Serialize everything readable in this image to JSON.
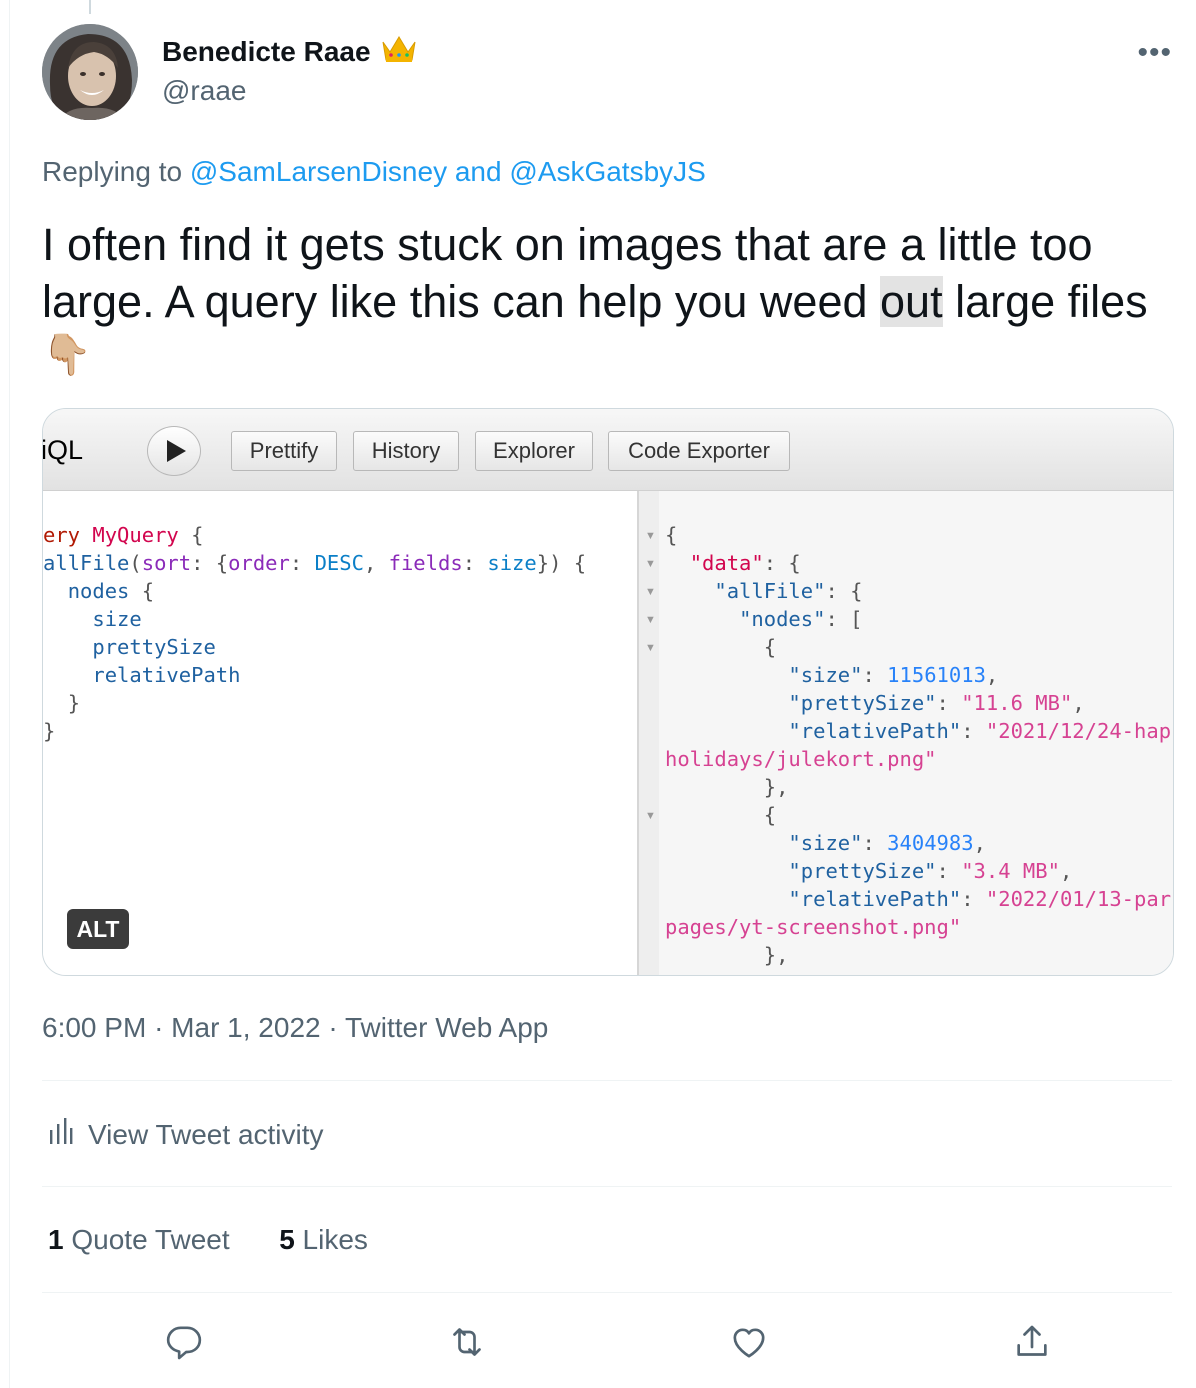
{
  "author": {
    "name": "Benedicte Raae",
    "badge_emoji": "👑",
    "handle": "@raae"
  },
  "more_label": "•••",
  "reply": {
    "prefix": "Replying to",
    "user1": "@SamLarsenDisney",
    "joiner": "and",
    "user2": "@AskGatsbyJS"
  },
  "tweet": {
    "line1": "I often find it gets stuck on images that are a little too",
    "line2_a": "large. A query like this can help you weed ",
    "line2_highlight": "out",
    "line2_b": " large files",
    "emoji": "👇🏼"
  },
  "media": {
    "toolbar": {
      "app_fragment": "iQL",
      "buttons": [
        "Prettify",
        "History",
        "Explorer",
        "Code Exporter"
      ]
    },
    "query": {
      "l1_kw": "ery",
      "l1_name": "MyQuery",
      "l1_brace": "{",
      "l2_field": "allFile",
      "l2_arg": "sort",
      "l2_k1": "order",
      "l2_v1": "DESC",
      "l2_k2": "fields",
      "l2_v2": "size",
      "l3": "nodes",
      "l4": "size",
      "l5": "prettySize",
      "l6": "relativePath"
    },
    "result": {
      "k_data": "\"data\"",
      "k_allfile": "\"allFile\"",
      "k_nodes": "\"nodes\"",
      "k_size": "\"size\"",
      "k_pretty": "\"prettySize\"",
      "k_rel": "\"relativePath\"",
      "n1_size": "11561013",
      "n1_pretty": "\"11.6 MB\"",
      "n1_path_a": "\"2021/12/24-hap",
      "n1_path_b": "holidays/julekort.png\"",
      "n2_size": "3404983",
      "n2_pretty": "\"3.4 MB\"",
      "n2_path_a": "\"2022/01/13-par",
      "n2_path_b": "pages/yt-screenshot.png\""
    },
    "alt_badge": "ALT"
  },
  "meta": {
    "time": "6:00 PM",
    "date": "Mar 1, 2022",
    "source": "Twitter Web App"
  },
  "activity_label": "View Tweet activity",
  "stats": {
    "quotes_count": "1",
    "quotes_label": "Quote Tweet",
    "likes_count": "5",
    "likes_label": "Likes"
  }
}
